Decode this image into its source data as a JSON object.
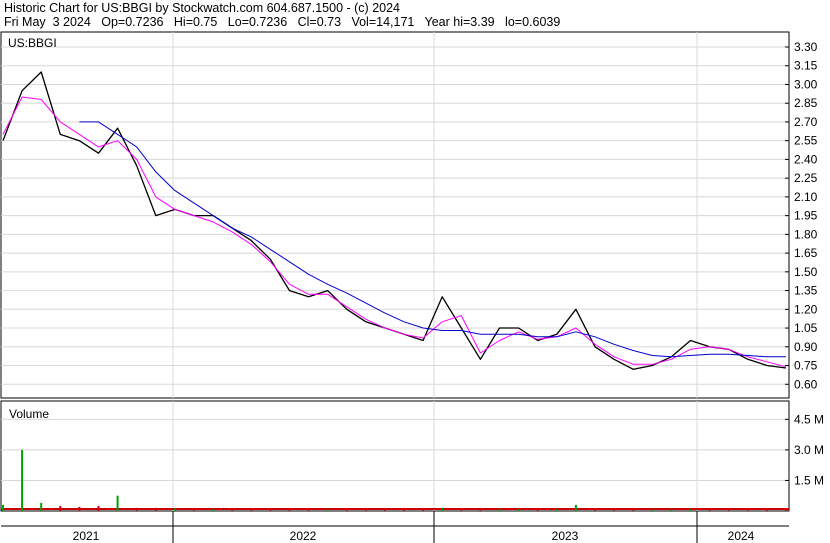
{
  "header": {
    "line1": "Historic Chart for US:BBGI by Stockwatch.com 604.687.1500 - (c) 2024",
    "line2": "Fri May  3 2024   Op=0.7236   Hi=0.75   Lo=0.7236   Cl=0.73   Vol=14,171   Year hi=3.39   lo=0.6039"
  },
  "chart_data": [
    {
      "type": "line",
      "name": "price-chart",
      "symbol_label": "US:BBGI",
      "x_tick_labels": [
        "2021",
        "2022",
        "2023",
        "2024"
      ],
      "y_ticks": [
        3.3,
        3.15,
        3.0,
        2.85,
        2.7,
        2.55,
        2.4,
        2.25,
        2.1,
        1.95,
        1.8,
        1.65,
        1.5,
        1.35,
        1.2,
        1.05,
        0.9,
        0.75,
        0.6
      ],
      "y_tick_labels": [
        "3.30",
        "3.15",
        "3.00",
        "2.85",
        "2.70",
        "2.55",
        "2.40",
        "2.25",
        "2.10",
        "1.95",
        "1.80",
        "1.65",
        "1.50",
        "1.35",
        "1.20",
        "1.05",
        "0.90",
        "0.75",
        "0.60"
      ],
      "ylim": [
        0.49,
        3.42
      ],
      "x": [
        "2020-12",
        "2021-01",
        "2021-02",
        "2021-03",
        "2021-04",
        "2021-05",
        "2021-06",
        "2021-07",
        "2021-08",
        "2021-09",
        "2021-10",
        "2021-11",
        "2021-12",
        "2022-01",
        "2022-02",
        "2022-03",
        "2022-04",
        "2022-05",
        "2022-06",
        "2022-07",
        "2022-08",
        "2022-09",
        "2022-10",
        "2022-11",
        "2022-12",
        "2023-01",
        "2023-02",
        "2023-03",
        "2023-04",
        "2023-05",
        "2023-06",
        "2023-07",
        "2023-08",
        "2023-09",
        "2023-10",
        "2023-11",
        "2023-12",
        "2024-01",
        "2024-02",
        "2024-03",
        "2024-04",
        "2024-05"
      ],
      "series": [
        {
          "color": "#000000",
          "values": [
            2.55,
            2.95,
            3.1,
            2.6,
            2.55,
            2.45,
            2.65,
            2.35,
            1.95,
            2.0,
            1.95,
            1.95,
            1.85,
            1.75,
            1.6,
            1.35,
            1.3,
            1.35,
            1.2,
            1.1,
            1.05,
            1.0,
            0.95,
            1.3,
            1.05,
            0.8,
            1.05,
            1.05,
            0.95,
            1.0,
            1.2,
            0.9,
            0.8,
            0.72,
            0.75,
            0.82,
            0.95,
            0.9,
            0.88,
            0.8,
            0.75,
            0.73
          ]
        },
        {
          "color": "#ff00ff",
          "values": [
            2.6,
            2.9,
            2.88,
            2.7,
            2.6,
            2.5,
            2.55,
            2.4,
            2.1,
            2.0,
            1.95,
            1.9,
            1.82,
            1.72,
            1.58,
            1.4,
            1.32,
            1.32,
            1.22,
            1.12,
            1.05,
            1.0,
            0.97,
            1.1,
            1.15,
            0.85,
            0.95,
            1.02,
            0.96,
            0.98,
            1.05,
            0.92,
            0.82,
            0.76,
            0.76,
            0.8,
            0.88,
            0.9,
            0.88,
            0.82,
            0.78,
            0.74
          ]
        },
        {
          "color": "#0000cc",
          "values": [
            null,
            null,
            null,
            null,
            2.7,
            2.7,
            2.6,
            2.5,
            2.3,
            2.15,
            2.05,
            1.95,
            1.85,
            1.78,
            1.68,
            1.58,
            1.48,
            1.4,
            1.33,
            1.25,
            1.17,
            1.1,
            1.05,
            1.03,
            1.03,
            1.0,
            1.0,
            1.0,
            0.98,
            0.98,
            1.02,
            0.98,
            0.92,
            0.87,
            0.83,
            0.82,
            0.83,
            0.84,
            0.84,
            0.83,
            0.82,
            0.82
          ]
        }
      ]
    },
    {
      "type": "bar",
      "name": "volume-chart",
      "panel_label": "Volume",
      "y_tick_labels": [
        "4.5 M",
        "3.0 M",
        "1.5 M"
      ],
      "y_ticks": [
        4.5,
        3.0,
        1.5
      ],
      "ylim": [
        0,
        5.4
      ],
      "x": [
        "2020-12",
        "2021-01",
        "2021-02",
        "2021-03",
        "2021-04",
        "2021-05",
        "2021-06",
        "2021-07",
        "2021-08",
        "2021-09",
        "2021-10",
        "2021-11",
        "2021-12",
        "2022-01",
        "2022-02",
        "2022-03",
        "2022-04",
        "2022-05",
        "2022-06",
        "2022-07",
        "2022-08",
        "2022-09",
        "2022-10",
        "2022-11",
        "2022-12",
        "2023-01",
        "2023-02",
        "2023-03",
        "2023-04",
        "2023-05",
        "2023-06",
        "2023-07",
        "2023-08",
        "2023-09",
        "2023-10",
        "2023-11",
        "2023-12",
        "2024-01",
        "2024-02",
        "2024-03",
        "2024-04",
        "2024-05"
      ],
      "values": [
        0.3,
        3.0,
        0.4,
        0.25,
        0.2,
        0.25,
        0.75,
        0.15,
        0.15,
        0.12,
        0.1,
        0.1,
        0.1,
        0.1,
        0.1,
        0.1,
        0.08,
        0.08,
        0.08,
        0.08,
        0.08,
        0.08,
        0.08,
        0.15,
        0.1,
        0.08,
        0.1,
        0.1,
        0.08,
        0.1,
        0.3,
        0.1,
        0.08,
        0.08,
        0.08,
        0.08,
        0.1,
        0.1,
        0.08,
        0.08,
        0.08,
        0.06
      ]
    }
  ]
}
